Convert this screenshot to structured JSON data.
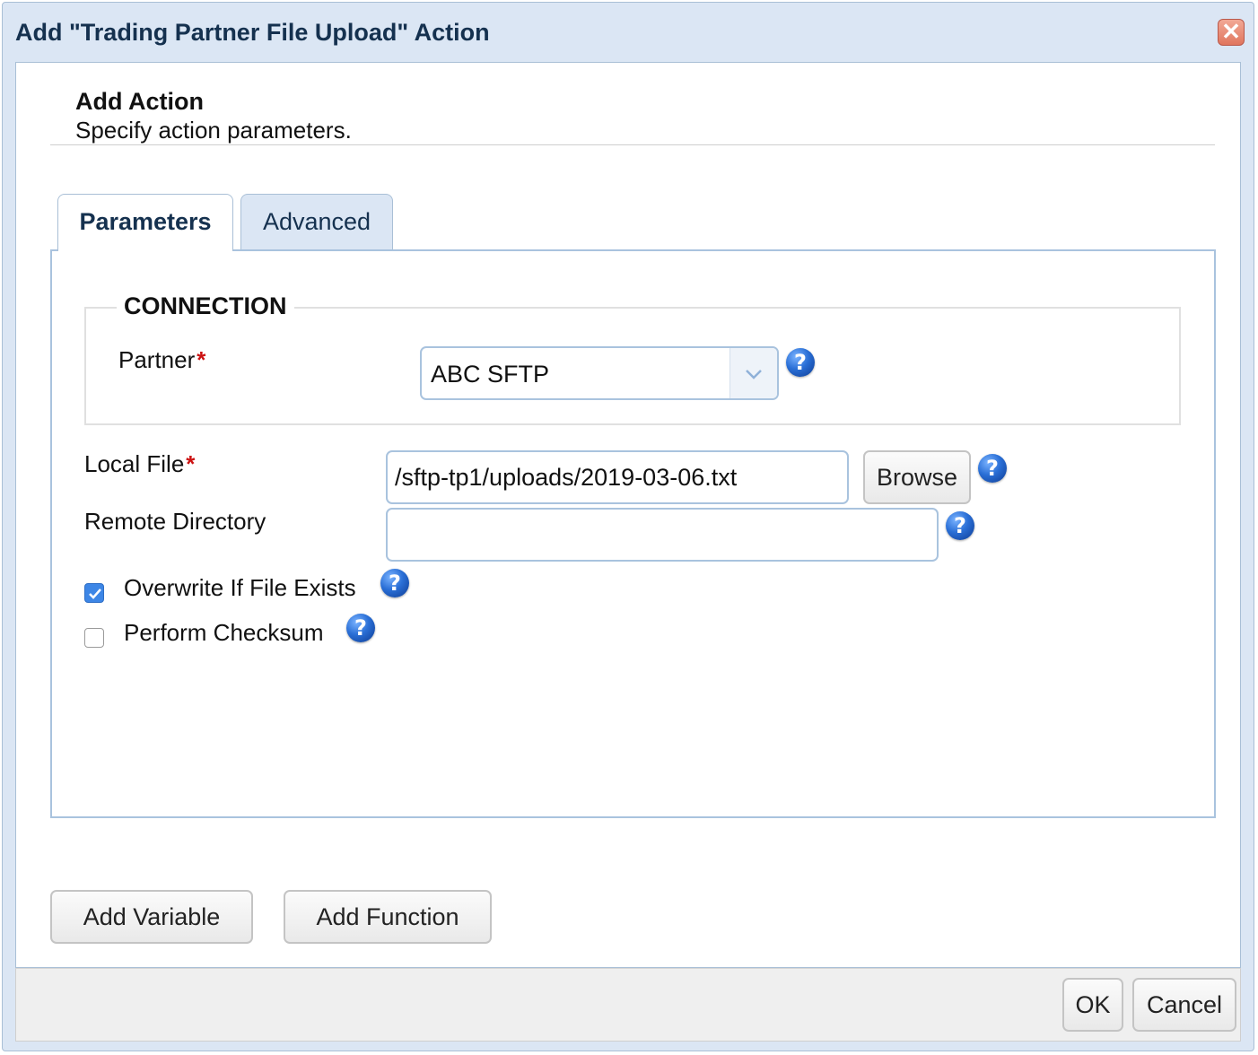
{
  "dialog": {
    "title": "Add \"Trading Partner File Upload\" Action",
    "close_label": "✕"
  },
  "header": {
    "title": "Add Action",
    "subtitle": "Specify action parameters."
  },
  "tabs": [
    {
      "label": "Parameters",
      "active": true
    },
    {
      "label": "Advanced",
      "active": false
    }
  ],
  "connection": {
    "legend": "CONNECTION",
    "partner_label": "Partner",
    "partner_value": "ABC SFTP"
  },
  "fields": {
    "required_mark": "*",
    "local_file_label": "Local File",
    "local_file_value": "/sftp-tp1/uploads/2019-03-06.txt",
    "browse_label": "Browse",
    "remote_dir_label": "Remote Directory",
    "remote_dir_value": ""
  },
  "options": {
    "overwrite_label": "Overwrite If File Exists",
    "overwrite_checked": true,
    "checksum_label": "Perform Checksum",
    "checksum_checked": false
  },
  "help_icon_glyph": "?",
  "actions": {
    "add_variable": "Add Variable",
    "add_function": "Add Function",
    "ok": "OK",
    "cancel": "Cancel"
  },
  "colors": {
    "title_text": "#15314f",
    "required": "#cc1111",
    "checkbox_checked": "#3d86e6",
    "help_icon": "#2a6fd6"
  }
}
